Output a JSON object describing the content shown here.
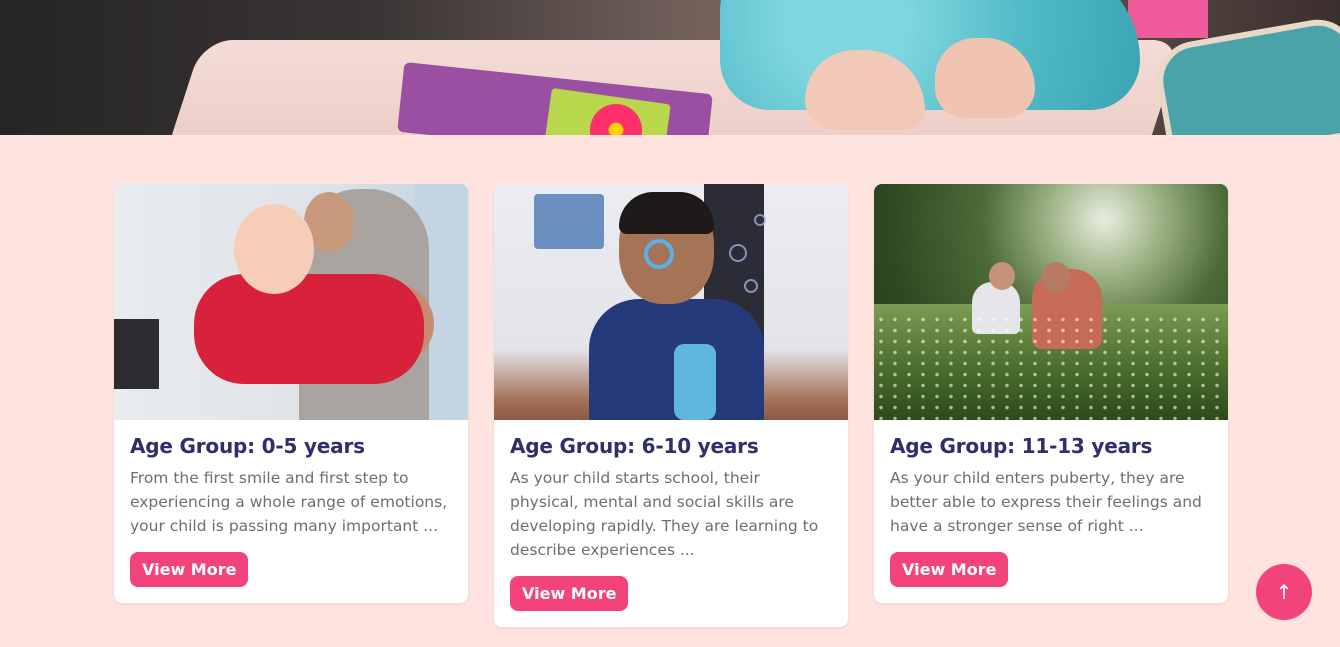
{
  "cards": [
    {
      "title": "Age Group: 0-5 years",
      "description": "From the first smile and first step to experiencing a whole range of emotions, your child is passing many important ...",
      "button_label": "View More"
    },
    {
      "title": "Age Group: 6-10 years",
      "description": "As your child starts school, their physical, mental and social skills are developing rapidly. They are learning to describe experiences ...",
      "button_label": "View More"
    },
    {
      "title": "Age Group: 11-13 years",
      "description": "As your child enters puberty, they are better able to express their feelings and have a stronger sense of right ...",
      "button_label": "View More"
    }
  ],
  "scroll_top": {
    "icon": "arrow-up-icon",
    "glyph": "↑"
  },
  "colors": {
    "page_background": "#ffe3df",
    "accent": "#f2437a",
    "title": "#2f2f6a",
    "body_text": "#6d6d76"
  }
}
